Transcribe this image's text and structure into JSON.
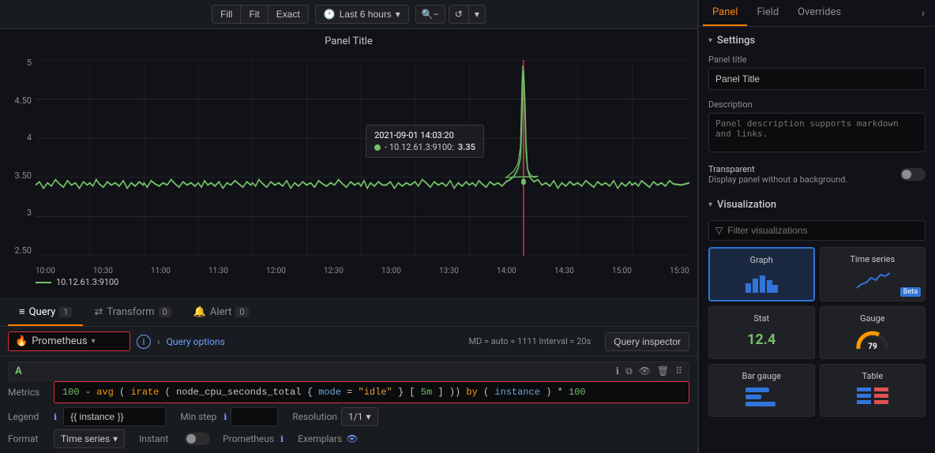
{
  "toolbar": {
    "fill_label": "Fill",
    "fit_label": "Fit",
    "exact_label": "Exact",
    "time_range": "Last 6 hours",
    "zoom_out_icon": "🔍",
    "refresh_icon": "↺",
    "chevron_icon": "▾"
  },
  "chart": {
    "title": "Panel Title",
    "y_labels": [
      "5",
      "4.50",
      "4",
      "3.50",
      "3",
      "2.50"
    ],
    "x_labels": [
      "10:00",
      "10:30",
      "11:00",
      "11:30",
      "12:00",
      "12:30",
      "13:00",
      "13:30",
      "14:00",
      "14:30",
      "15:00",
      "15:30"
    ],
    "legend_label": "10.12.61.3:9100",
    "tooltip": {
      "time": "2021-09-01 14:03:20",
      "series": "- 10.12.61.3:9100:",
      "value": "3.35"
    }
  },
  "query_panel": {
    "tabs": [
      {
        "label": "Query",
        "badge": "1",
        "icon": "≡"
      },
      {
        "label": "Transform",
        "badge": "0",
        "icon": "⇄"
      },
      {
        "label": "Alert",
        "badge": "0",
        "icon": "🔔"
      }
    ],
    "datasource": {
      "name": "Prometheus",
      "fire_icon": "🔥"
    },
    "query_options_label": "Query options",
    "meta": "MD = auto = 1111   Interval = 20s",
    "query_inspector_label": "Query inspector",
    "query_group": {
      "label": "A",
      "metrics_label": "Metrics",
      "query_value": "100 -avg(irate(node_cpu_seconds_total{mode=\"idle\"}[5m])) by (instance)* 100",
      "legend_label": "Legend",
      "legend_value": "{{ instance }}",
      "minstep_label": "Min step",
      "resolution_label": "Resolution",
      "resolution_value": "1/1",
      "format_label": "Format",
      "format_value": "Time series",
      "instant_label": "Instant",
      "prometheus_label": "Prometheus",
      "exemplars_label": "Exemplars"
    }
  },
  "right_panel": {
    "tabs": [
      "Panel",
      "Field",
      "Overrides"
    ],
    "active_tab": "Panel",
    "sections": {
      "settings": {
        "title": "Settings",
        "panel_title_label": "Panel title",
        "panel_title_value": "Panel Title",
        "description_label": "Description",
        "description_placeholder": "Panel description supports markdown and links.",
        "transparent_label": "Transparent",
        "transparent_desc": "Display panel without a background."
      },
      "visualization": {
        "title": "Visualization",
        "filter_placeholder": "Filter visualizations",
        "items": [
          {
            "name": "Graph",
            "type": "graph",
            "active": true
          },
          {
            "name": "Time series",
            "type": "time-series",
            "beta": true
          },
          {
            "name": "Stat",
            "type": "stat",
            "value": "12.4"
          },
          {
            "name": "Gauge",
            "type": "gauge",
            "value": "79"
          },
          {
            "name": "Bar gauge",
            "type": "bar-gauge"
          },
          {
            "name": "Table",
            "type": "table"
          }
        ]
      }
    }
  }
}
